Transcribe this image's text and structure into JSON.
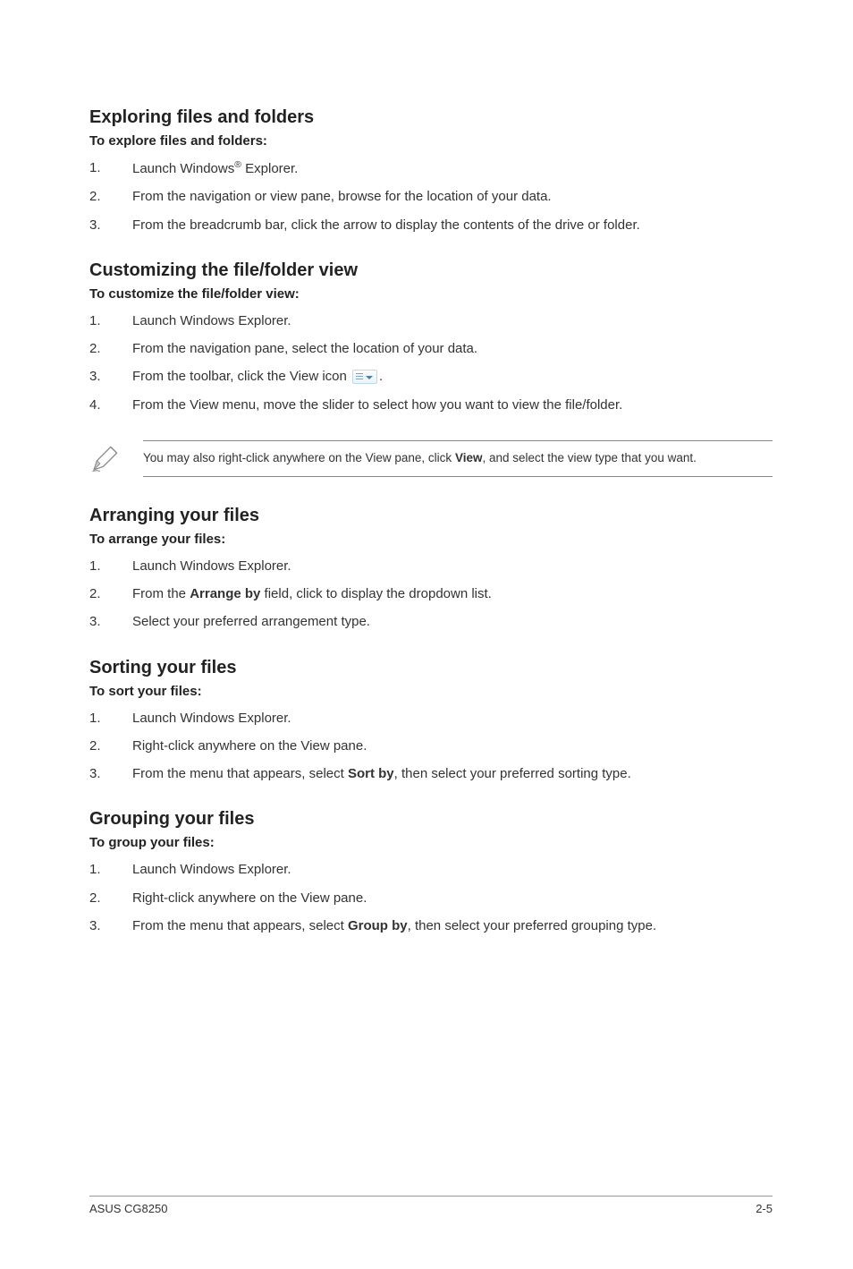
{
  "sections": {
    "exploring": {
      "heading": "Exploring files and folders",
      "sub": "To explore files and folders:",
      "items": [
        {
          "n": "1.",
          "pre": "Launch Windows",
          "sup": "®",
          "post": " Explorer."
        },
        {
          "n": "2.",
          "text": "From the navigation or view pane, browse for the location of your data."
        },
        {
          "n": "3.",
          "text": "From the breadcrumb bar, click the arrow to display the contents of the drive or folder."
        }
      ]
    },
    "customizing": {
      "heading": "Customizing the file/folder view",
      "sub": "To customize the file/folder view:",
      "items": [
        {
          "n": "1.",
          "text": "Launch Windows Explorer."
        },
        {
          "n": "2.",
          "text": "From the navigation pane, select the location of your data."
        },
        {
          "n": "3.",
          "pre": "From the toolbar, click the View icon ",
          "icon": "view-icon",
          "post": "."
        },
        {
          "n": "4.",
          "text": "From the View menu, move the slider to select how you want to view the file/folder."
        }
      ]
    },
    "note": {
      "pre": "You may also right-click anywhere on the View pane, click ",
      "bold": "View",
      "post": ", and select the view type that you want."
    },
    "arranging": {
      "heading": "Arranging your files",
      "sub": "To arrange your files:",
      "items": [
        {
          "n": "1.",
          "text": "Launch Windows Explorer."
        },
        {
          "n": "2.",
          "pre": "From the ",
          "bold": "Arrange by",
          "post": " field, click to display the dropdown list."
        },
        {
          "n": "3.",
          "text": "Select your preferred arrangement type."
        }
      ]
    },
    "sorting": {
      "heading": "Sorting your files",
      "sub": "To sort your files:",
      "items": [
        {
          "n": "1.",
          "text": "Launch Windows Explorer."
        },
        {
          "n": "2.",
          "text": "Right-click anywhere on the View pane."
        },
        {
          "n": "3.",
          "pre": "From the menu that appears, select ",
          "bold": "Sort by",
          "post": ", then select your preferred sorting type."
        }
      ]
    },
    "grouping": {
      "heading": "Grouping your files",
      "sub": "To group your files:",
      "items": [
        {
          "n": "1.",
          "text": "Launch Windows Explorer."
        },
        {
          "n": "2.",
          "text": "Right-click anywhere on the View pane."
        },
        {
          "n": "3.",
          "pre": "From the menu that appears, select ",
          "bold": "Group by",
          "post": ", then select your preferred grouping type."
        }
      ]
    }
  },
  "footer": {
    "left": "ASUS CG8250",
    "right": "2-5"
  }
}
